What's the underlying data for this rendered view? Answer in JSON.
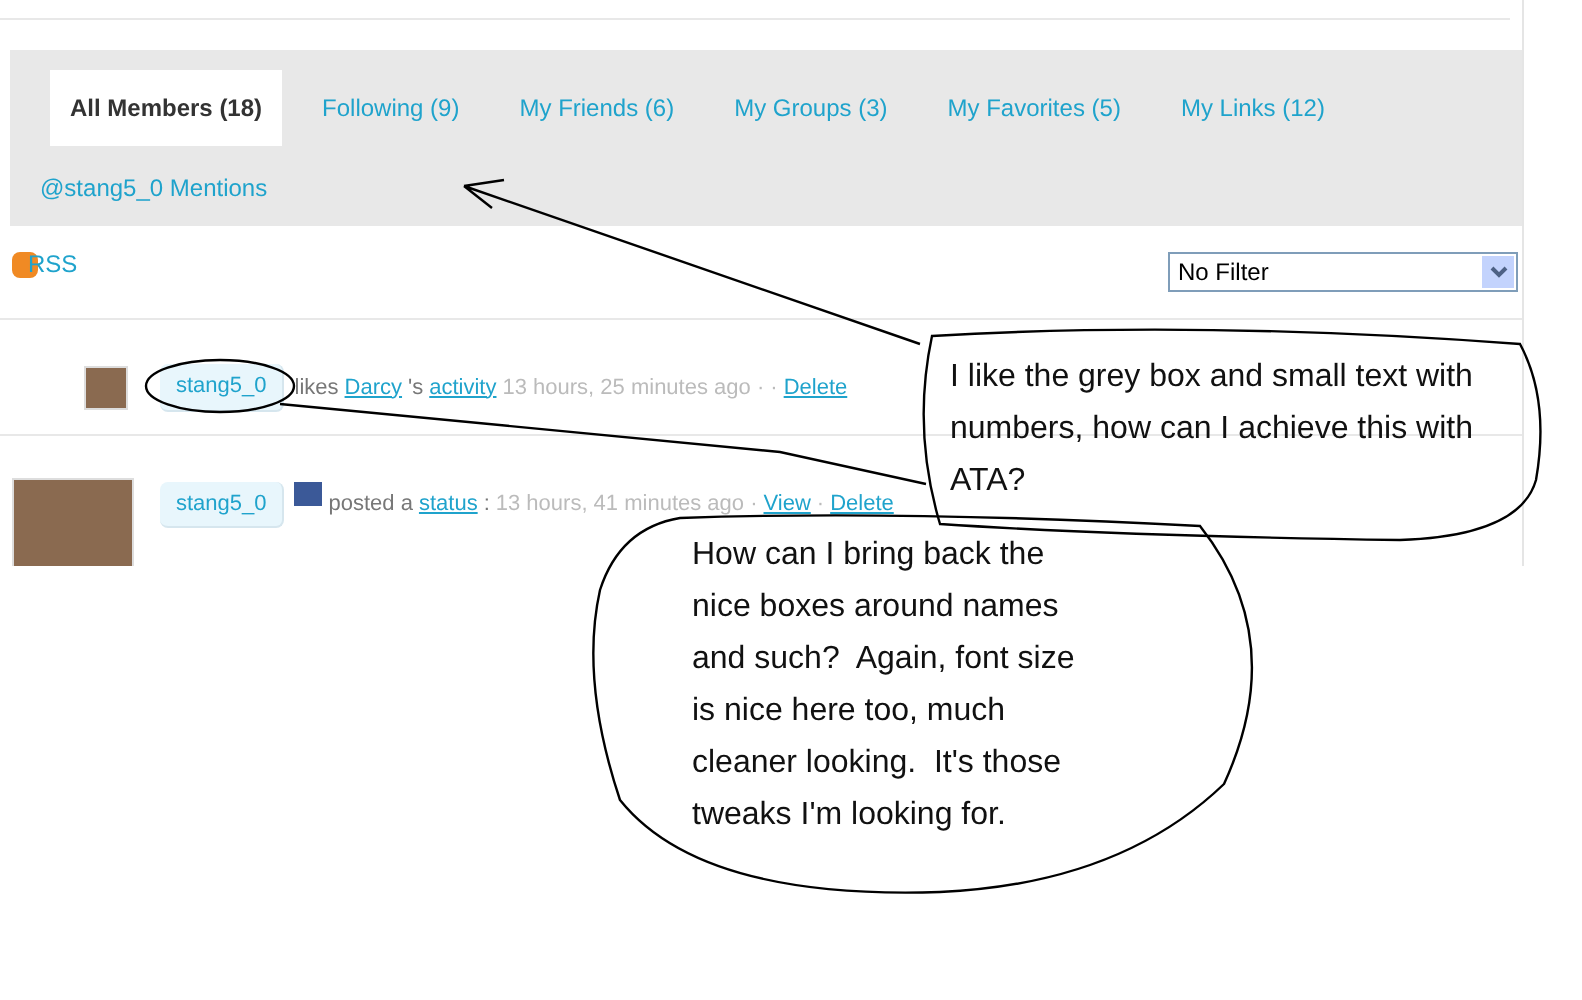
{
  "tabs": [
    {
      "label": "All Members (18)",
      "selected": true
    },
    {
      "label": "Following (9)",
      "selected": false
    },
    {
      "label": "My Friends (6)",
      "selected": false
    },
    {
      "label": "My Groups (3)",
      "selected": false
    },
    {
      "label": "My Favorites (5)",
      "selected": false
    },
    {
      "label": "My Links (12)",
      "selected": false
    }
  ],
  "mentions_link": "@stang5_0 Mentions",
  "rss_link": "RSS",
  "filter": {
    "value": "No Filter"
  },
  "activity": [
    {
      "kind": "like",
      "name": "stang5_0",
      "source_icon": false,
      "segments": [
        {
          "kind": "text",
          "text": "likes"
        },
        {
          "kind": "link",
          "text": "Darcy"
        },
        {
          "kind": "text",
          "text": "'s"
        },
        {
          "kind": "link",
          "text": "activity"
        },
        {
          "kind": "time",
          "text": "13 hours, 25 minutes ago · ·"
        },
        {
          "kind": "link",
          "text": "Delete"
        }
      ]
    },
    {
      "kind": "status",
      "name": "stang5_0",
      "source_icon": true,
      "segments": [
        {
          "kind": "text",
          "text": "posted a"
        },
        {
          "kind": "link",
          "text": "status"
        },
        {
          "kind": "text",
          "text": ":"
        },
        {
          "kind": "time",
          "text": "13 hours, 41 minutes ago ·"
        },
        {
          "kind": "link",
          "text": "View"
        },
        {
          "kind": "time",
          "text": "·"
        },
        {
          "kind": "link",
          "text": "Delete"
        }
      ]
    }
  ],
  "annotations": [
    {
      "kind": "callout",
      "text": "I like the grey box and small text with numbers, how can I achieve this with ATA?"
    },
    {
      "kind": "callout",
      "text": "How can I bring back the nice boxes around names and such?  Again, font size is nice here too, much cleaner looking.  It's those tweaks I'm looking for."
    }
  ]
}
